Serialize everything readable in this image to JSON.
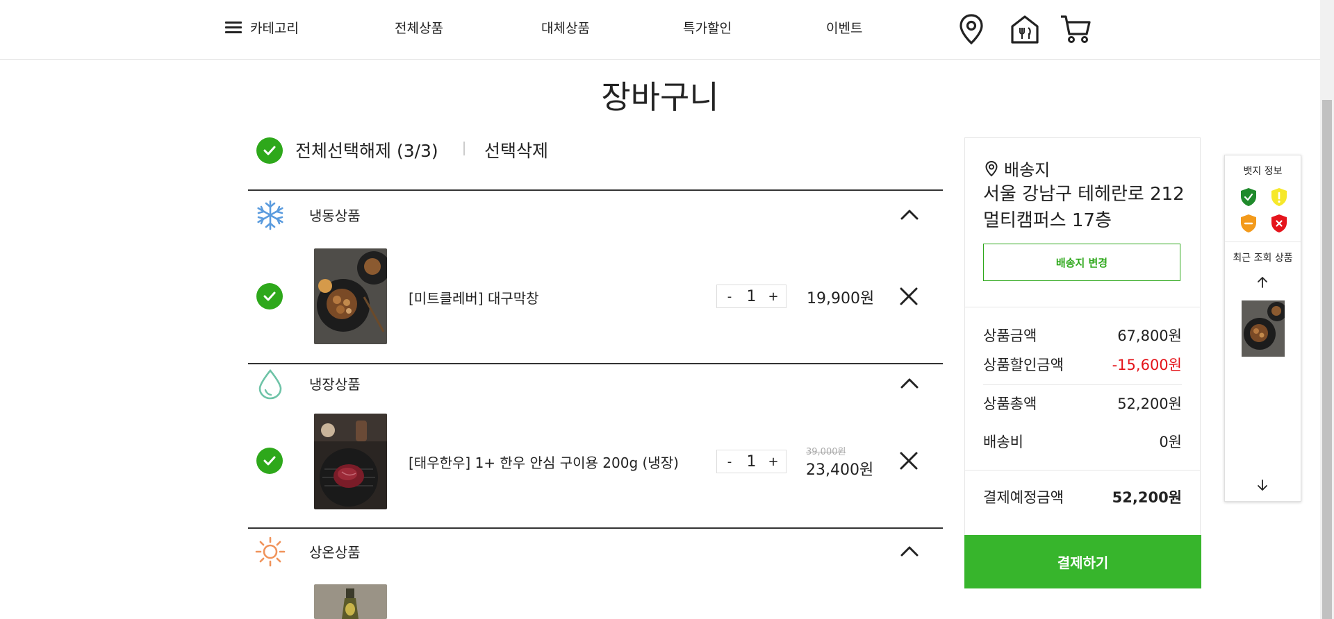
{
  "header": {
    "category_label": "카테고리",
    "nav": [
      "전체상품",
      "대체상품",
      "특가할인",
      "이벤트"
    ],
    "icons": [
      "location-pin-icon",
      "store-icon",
      "cart-icon"
    ]
  },
  "page_title": "장바구니",
  "select_bar": {
    "select_all_label": "전체선택해제 (3/3)",
    "delete_selected_label": "선택삭제"
  },
  "groups": [
    {
      "label": "냉동상품",
      "icon": "snowflake-icon",
      "items": [
        {
          "name": "[미트클레버] 대구막창",
          "qty": "1",
          "price": "19,900원",
          "original_price": ""
        }
      ]
    },
    {
      "label": "냉장상품",
      "icon": "water-drop-icon",
      "items": [
        {
          "name": "[태우한우] 1+ 한우 안심 구이용 200g (냉장)",
          "qty": "1",
          "price": "23,400원",
          "original_price": "39,000원"
        }
      ]
    },
    {
      "label": "상온상품",
      "icon": "sun-icon",
      "items": []
    }
  ],
  "stepper": {
    "minus": "-",
    "plus": "+"
  },
  "summary": {
    "delivery_label": "배송지",
    "address_line1": "서울 강남구 테헤란로 212",
    "address_line2": "멀티캠퍼스 17층",
    "change_address_label": "배송지 변경",
    "rows": [
      {
        "label": "상품금액",
        "value": "67,800원"
      },
      {
        "label": "상품할인금액",
        "value": "-15,600원"
      },
      {
        "label": "상품총액",
        "value": "52,200원"
      },
      {
        "label": "배송비",
        "value": "0원"
      }
    ],
    "total_label": "결제예정금액",
    "total_value": "52,200원",
    "pay_label": "결제하기"
  },
  "side_widget": {
    "badge_title": "뱃지 정보",
    "badges": [
      "shield-check-icon",
      "shield-warning-icon",
      "shield-minus-icon",
      "shield-x-icon"
    ],
    "recent_title": "최근 조회 상품"
  },
  "colors": {
    "accent_green": "#2ea81b",
    "pay_green": "#37b52c",
    "discount_red": "#e4141a"
  }
}
